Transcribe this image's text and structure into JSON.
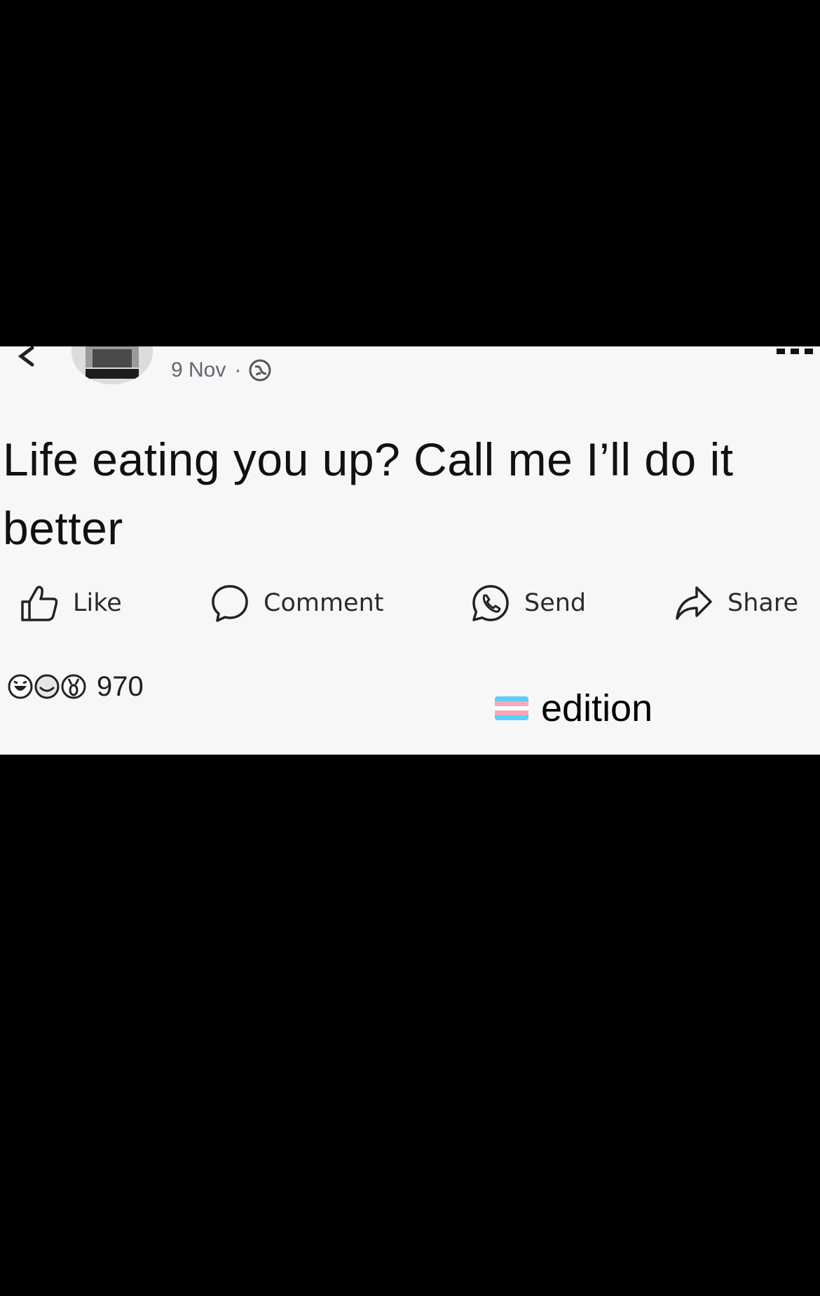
{
  "post": {
    "date": "9 Nov",
    "separator": "·",
    "audience_icon": "globe-icon",
    "text": "Life eating you up? Call me I’ll do it better"
  },
  "actions": [
    {
      "label": "Like",
      "icon": "thumbs-up-icon"
    },
    {
      "label": "Comment",
      "icon": "comment-icon"
    },
    {
      "label": "Send",
      "icon": "whatsapp-icon"
    },
    {
      "label": "Share",
      "icon": "share-arrow-icon"
    }
  ],
  "reactions": {
    "count": "970",
    "icons": [
      "laugh-reaction-icon",
      "care-reaction-icon",
      "wow-reaction-icon"
    ]
  },
  "caption": {
    "flag_icon": "transgender-flag-icon",
    "flag_colors": [
      "#5BCEFA",
      "#F5A9B8",
      "#FFFFFF",
      "#F5A9B8",
      "#5BCEFA"
    ],
    "text": "edition"
  }
}
